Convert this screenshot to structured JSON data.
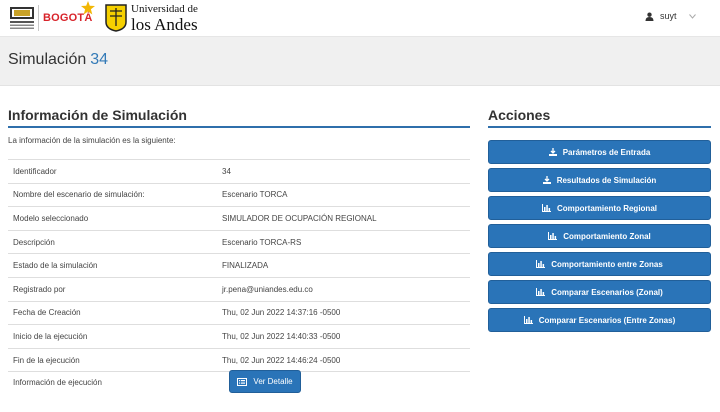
{
  "header": {
    "logo_bogota_text": "BOGOTÁ",
    "logo_andes_line1": "Universidad de",
    "logo_andes_line2": "los Andes",
    "user_name": "suyt"
  },
  "page": {
    "title": "Simulación",
    "title_number": "34"
  },
  "info": {
    "heading": "Información de Simulación",
    "intro": "La información de la simulación es la siguiente:",
    "rows": [
      {
        "label": "Identificador",
        "value": "34"
      },
      {
        "label": "Nombre del escenario de simulación:",
        "value": "Escenario TORCA"
      },
      {
        "label": "Modelo seleccionado",
        "value": "SIMULADOR DE OCUPACIÓN REGIONAL"
      },
      {
        "label": "Descripción",
        "value": "Escenario TORCA-RS"
      },
      {
        "label": "Estado de la simulación",
        "value": "FINALIZADA"
      },
      {
        "label": "Registrado por",
        "value": "jr.pena@uniandes.edu.co"
      },
      {
        "label": "Fecha de Creación",
        "value": "Thu, 02 Jun 2022 14:37:16 -0500"
      },
      {
        "label": "Inicio de la ejecución",
        "value": "Thu, 02 Jun 2022 14:40:33 -0500"
      },
      {
        "label": "Fin de la ejecución",
        "value": "Thu, 02 Jun 2022 14:46:24 -0500"
      },
      {
        "label": "Información de ejecución",
        "value": ""
      }
    ],
    "detail_button": "Ver Detalle"
  },
  "actions": {
    "heading": "Acciones",
    "buttons": [
      {
        "label": "Parámetros de Entrada",
        "icon": "download-icon"
      },
      {
        "label": "Resultados de Simulación",
        "icon": "download-icon"
      },
      {
        "label": "Comportamiento Regional",
        "icon": "bar-chart-icon"
      },
      {
        "label": "Comportamiento Zonal",
        "icon": "bar-chart-icon"
      },
      {
        "label": "Comportamiento entre Zonas",
        "icon": "bar-chart-icon"
      },
      {
        "label": "Comparar Escenarios (Zonal)",
        "icon": "bar-chart-icon"
      },
      {
        "label": "Comparar Escenarios (Entre Zonas)",
        "icon": "bar-chart-icon"
      }
    ]
  },
  "colors": {
    "primary": "#2a74b8",
    "title_number": "#337ab7",
    "rule": "#2f6fab",
    "band": "#f0f0f0"
  }
}
